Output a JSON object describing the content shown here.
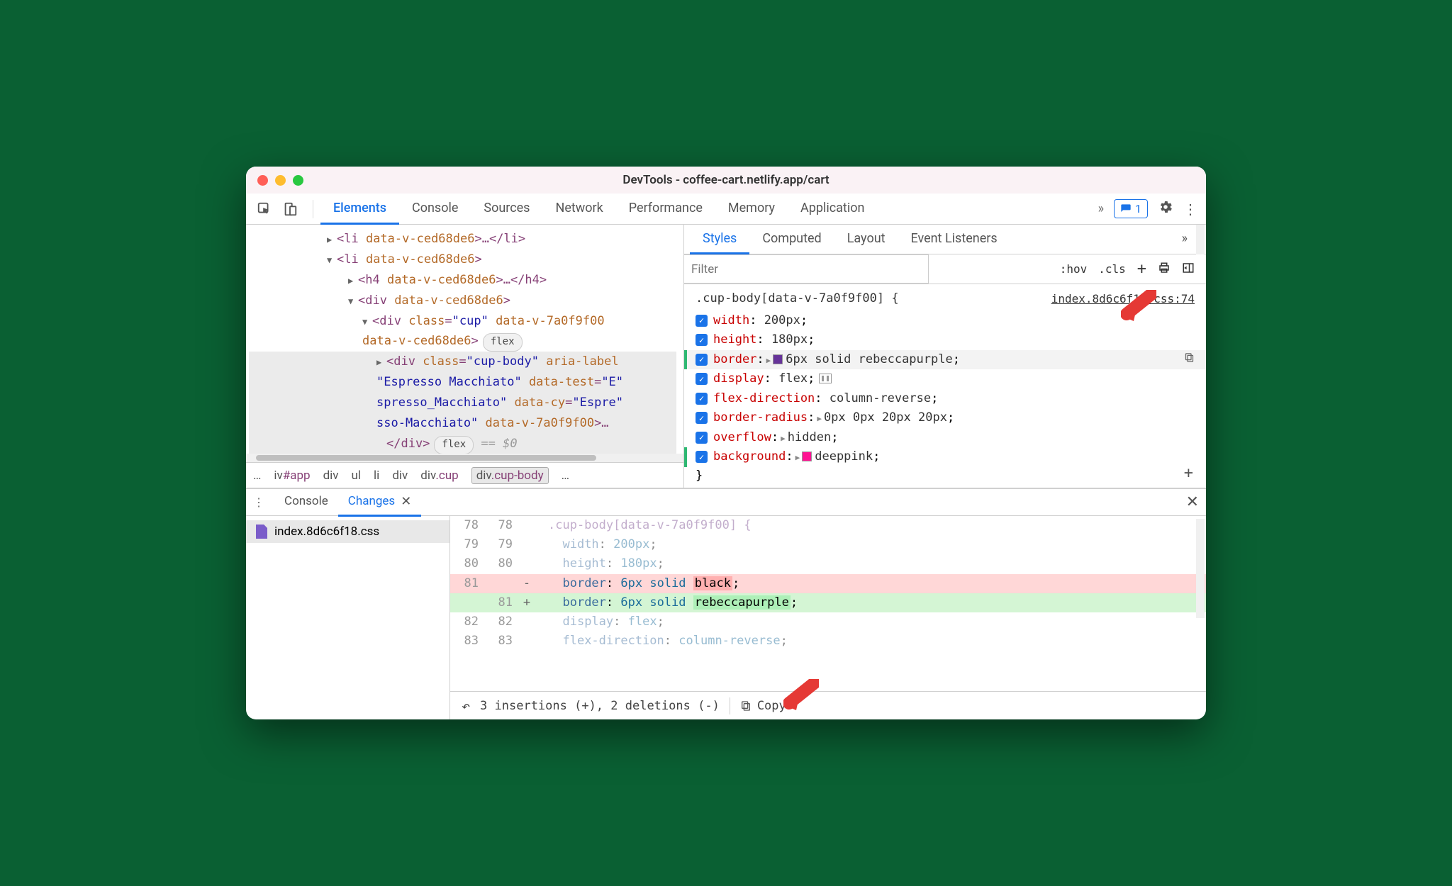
{
  "window": {
    "title": "DevTools - coffee-cart.netlify.app/cart"
  },
  "toolbar": {
    "tabs": [
      "Elements",
      "Console",
      "Sources",
      "Network",
      "Performance",
      "Memory",
      "Application"
    ],
    "active_tab": "Elements",
    "more": "»",
    "issues_count": "1"
  },
  "dom": {
    "lines": [
      {
        "ind": 1,
        "tri": "▶",
        "open": "<li ",
        "attrs": [
          {
            "n": "data-v-ced68de6",
            "v": ""
          }
        ],
        "close": ">…</li>"
      },
      {
        "ind": 1,
        "tri": "▼",
        "open": "<li ",
        "attrs": [
          {
            "n": "data-v-ced68de6",
            "v": ""
          }
        ],
        "close": ">"
      },
      {
        "ind": 2,
        "tri": "▶",
        "open": "<h4 ",
        "attrs": [
          {
            "n": "data-v-ced68de6",
            "v": ""
          }
        ],
        "close": ">…</h4>"
      },
      {
        "ind": 2,
        "tri": "▼",
        "open": "<div ",
        "attrs": [
          {
            "n": "data-v-ced68de6",
            "v": ""
          }
        ],
        "close": ">"
      },
      {
        "ind": 3,
        "tri": "▼",
        "open": "<div ",
        "attrs": [
          {
            "n": "class",
            "v": "cup"
          },
          {
            "n": "data-v-7a0f9f00",
            "v": ""
          }
        ],
        "wrap": true
      },
      {
        "ind": 3,
        "cont": true,
        "attrs": [
          {
            "n": "data-v-ced68de6",
            "v": ""
          }
        ],
        "close": ">",
        "flex": true
      },
      {
        "ind": 4,
        "tri": "▶",
        "sel": true,
        "open": "<div ",
        "attrs": [
          {
            "n": "class",
            "v": "cup-body"
          },
          {
            "n": "aria-label",
            "v": ""
          }
        ],
        "wrap": true
      },
      {
        "ind": 4,
        "cont": true,
        "sel": true,
        "rawv": "\"Espresso Macchiato\" ",
        "attrs": [
          {
            "n": "data-test",
            "v": "E"
          }
        ],
        "wrap": true
      },
      {
        "ind": 4,
        "cont": true,
        "sel": true,
        "rawv": "spresso_Macchiato\" ",
        "attrs": [
          {
            "n": "data-cy",
            "v": "Espre"
          }
        ],
        "wrap": true
      },
      {
        "ind": 4,
        "cont": true,
        "sel": true,
        "rawv": "sso-Macchiato\" ",
        "attrs": [
          {
            "n": "data-v-7a0f9f00",
            "v": ""
          }
        ],
        "close": ">…"
      },
      {
        "ind": 4,
        "tri": "",
        "sel": true,
        "open": "</div>",
        "flex": true,
        "eq0": true
      }
    ],
    "crumbs": [
      "…",
      "iv#app",
      "div",
      "ul",
      "li",
      "div",
      "div.cup",
      "div.cup-body",
      "…"
    ],
    "crumb_active": 7
  },
  "styles": {
    "tabs": [
      "Styles",
      "Computed",
      "Layout",
      "Event Listeners"
    ],
    "active_tab": "Styles",
    "more": "»",
    "filter_placeholder": "Filter",
    "hov": ":hov",
    "cls": ".cls",
    "selector": ".cup-body[data-v-7a0f9f00] {",
    "source": "index.8d6c6f18.css:74",
    "props": [
      {
        "n": "width",
        "v": "200px"
      },
      {
        "n": "height",
        "v": "180px"
      },
      {
        "n": "border",
        "tri": true,
        "v": "6px solid ",
        "swatch": "sw-purple",
        "v2": "rebeccapurple",
        "hl": true,
        "edit": true,
        "copy": true
      },
      {
        "n": "display",
        "v": "flex",
        "flexic": true
      },
      {
        "n": "flex-direction",
        "v": "column-reverse"
      },
      {
        "n": "border-radius",
        "tri": true,
        "v": "0px 0px 20px 20px"
      },
      {
        "n": "overflow",
        "tri": true,
        "v": "hidden"
      },
      {
        "n": "background",
        "tri": true,
        "swatch": "sw-pink",
        "v": "deeppink",
        "edit": true
      }
    ],
    "close": "}"
  },
  "drawer": {
    "tabs": [
      "Console",
      "Changes"
    ],
    "active": "Changes",
    "file": "index.8d6c6f18.css",
    "diff": [
      {
        "l": "78",
        "r": "78",
        "faded": true,
        "code_sel": ".cup-body[data-v-7a0f9f00] {",
        "is_sel": true
      },
      {
        "l": "79",
        "r": "79",
        "faded": true,
        "prop": "width",
        "val": "200px"
      },
      {
        "l": "80",
        "r": "80",
        "faded": true,
        "prop": "height",
        "val": "180px"
      },
      {
        "l": "81",
        "r": "",
        "sign": "-",
        "del": true,
        "prop": "border",
        "val_pre": "6px solid ",
        "val_hl": "black",
        "hl_cls": "css-black"
      },
      {
        "l": "",
        "r": "81",
        "sign": "+",
        "add": true,
        "prop": "border",
        "val_pre": "6px solid ",
        "val_hl": "rebeccapurple",
        "hl_cls": "css-rebecca"
      },
      {
        "l": "82",
        "r": "82",
        "faded": true,
        "prop": "display",
        "val": "flex"
      },
      {
        "l": "83",
        "r": "83",
        "faded": true,
        "prop": "flex-direction",
        "val": "column-reverse"
      }
    ],
    "footer": {
      "summary": "3 insertions (+), 2 deletions (-)",
      "copy": "Copy"
    }
  }
}
